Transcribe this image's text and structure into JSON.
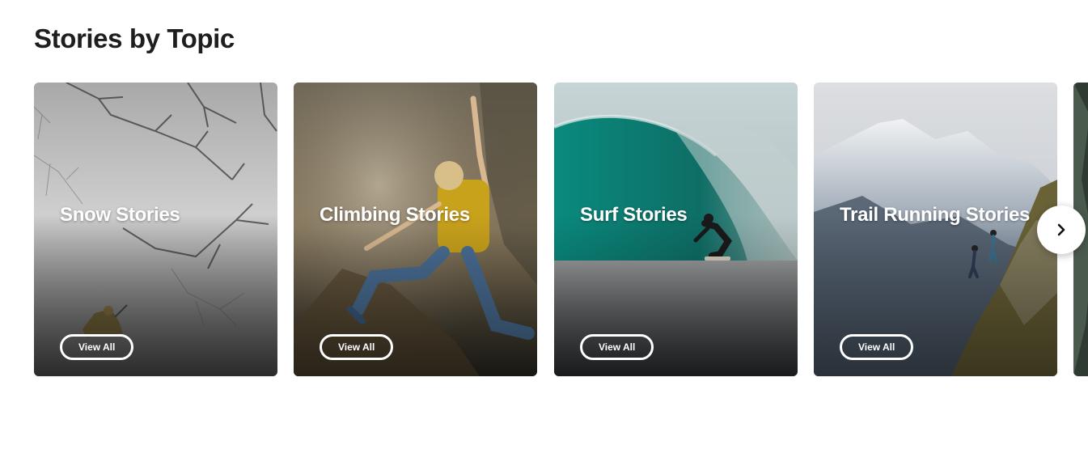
{
  "section": {
    "title": "Stories by Topic"
  },
  "cards": [
    {
      "title": "Snow Stories",
      "button_label": "View All",
      "image_icon": "snow-forest-image",
      "colors": {
        "top": "#a8a8a8",
        "middle": "#c9c9c9",
        "bottom": "#565656"
      }
    },
    {
      "title": "Climbing Stories",
      "button_label": "View All",
      "image_icon": "climber-rock-image",
      "colors": {
        "top": "#6b6355",
        "middle": "#8e7d60",
        "bottom": "#2c2a22"
      }
    },
    {
      "title": "Surf Stories",
      "button_label": "View All",
      "image_icon": "surf-wave-image",
      "colors": {
        "top": "#b9c9cb",
        "middle": "#0f7d72",
        "bottom": "#3a3c3e"
      }
    },
    {
      "title": "Trail Running Stories",
      "button_label": "View All",
      "image_icon": "mountain-trail-image",
      "colors": {
        "top": "#d7d9dc",
        "middle": "#5d6a78",
        "bottom": "#3e3b2a"
      }
    },
    {
      "title": "",
      "button_label": "",
      "image_icon": "partial-card-image",
      "colors": {
        "top": "#3d4a3e",
        "middle": "#2f3a32",
        "bottom": "#1f2521"
      }
    }
  ],
  "carousel": {
    "next_icon": "chevron-right-icon"
  }
}
